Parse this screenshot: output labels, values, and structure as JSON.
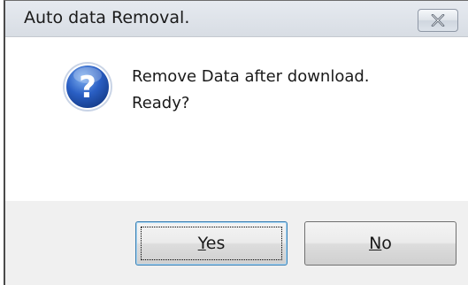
{
  "dialog": {
    "title": "Auto data Removal.",
    "message_line1": "Remove Data after download.",
    "message_line2": "Ready?",
    "icon": "question-icon"
  },
  "buttons": {
    "yes_mnemonic": "Y",
    "yes_rest": "es",
    "no_mnemonic": "N",
    "no_rest": "o"
  },
  "colors": {
    "icon_blue": "#2a5fc4",
    "content_bg": "#ffffff",
    "footer_bg": "#f0f0f0"
  }
}
